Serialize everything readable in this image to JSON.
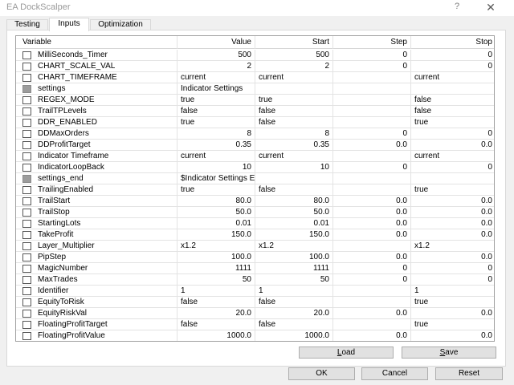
{
  "window": {
    "title": "EA DockScalper",
    "help_glyph": "?",
    "close_glyph": "✕"
  },
  "tabs": [
    "Testing",
    "Inputs",
    "Optimization"
  ],
  "table": {
    "columns": [
      "Variable",
      "Value",
      "Start",
      "Step",
      "Stop"
    ],
    "rows": [
      {
        "var": "MilliSeconds_Timer",
        "checked": false,
        "value": "500",
        "start": "500",
        "step": "0",
        "stop": "0",
        "kind": "num"
      },
      {
        "var": "CHART_SCALE_VAL",
        "checked": false,
        "value": "2",
        "start": "2",
        "step": "0",
        "stop": "0",
        "kind": "num"
      },
      {
        "var": "CHART_TIMEFRAME",
        "checked": false,
        "value": "current",
        "start": "current",
        "step": "",
        "stop": "current",
        "kind": "text"
      },
      {
        "var": "settings",
        "checked": true,
        "value": "Indicator Settings",
        "start": "",
        "step": "",
        "stop": "",
        "kind": "text"
      },
      {
        "var": "REGEX_MODE",
        "checked": false,
        "value": "true",
        "start": "true",
        "step": "",
        "stop": "false",
        "kind": "text"
      },
      {
        "var": "TrailTPLevels",
        "checked": false,
        "value": "false",
        "start": "false",
        "step": "",
        "stop": "false",
        "kind": "text"
      },
      {
        "var": "DDR_ENABLED",
        "checked": false,
        "value": "true",
        "start": "false",
        "step": "",
        "stop": "true",
        "kind": "text"
      },
      {
        "var": "DDMaxOrders",
        "checked": false,
        "value": "8",
        "start": "8",
        "step": "0",
        "stop": "0",
        "kind": "num"
      },
      {
        "var": "DDProfitTarget",
        "checked": false,
        "value": "0.35",
        "start": "0.35",
        "step": "0.0",
        "stop": "0.0",
        "kind": "num"
      },
      {
        "var": "Indicator Timeframe",
        "checked": false,
        "value": "current",
        "start": "current",
        "step": "",
        "stop": "current",
        "kind": "text"
      },
      {
        "var": "IndicatorLoopBack",
        "checked": false,
        "value": "10",
        "start": "10",
        "step": "0",
        "stop": "0",
        "kind": "num"
      },
      {
        "var": "settings_end",
        "checked": true,
        "value": "$Indicator Settings End",
        "start": "",
        "step": "",
        "stop": "",
        "kind": "text"
      },
      {
        "var": "TrailingEnabled",
        "checked": false,
        "value": "true",
        "start": "false",
        "step": "",
        "stop": "true",
        "kind": "text"
      },
      {
        "var": "TrailStart",
        "checked": false,
        "value": "80.0",
        "start": "80.0",
        "step": "0.0",
        "stop": "0.0",
        "kind": "num"
      },
      {
        "var": "TrailStop",
        "checked": false,
        "value": "50.0",
        "start": "50.0",
        "step": "0.0",
        "stop": "0.0",
        "kind": "num"
      },
      {
        "var": "StartingLots",
        "checked": false,
        "value": "0.01",
        "start": "0.01",
        "step": "0.0",
        "stop": "0.0",
        "kind": "num"
      },
      {
        "var": "TakeProfit",
        "checked": false,
        "value": "150.0",
        "start": "150.0",
        "step": "0.0",
        "stop": "0.0",
        "kind": "num"
      },
      {
        "var": "Layer_Multiplier",
        "checked": false,
        "value": "x1.2",
        "start": "x1.2",
        "step": "",
        "stop": "x1.2",
        "kind": "text"
      },
      {
        "var": "PipStep",
        "checked": false,
        "value": "100.0",
        "start": "100.0",
        "step": "0.0",
        "stop": "0.0",
        "kind": "num"
      },
      {
        "var": "MagicNumber",
        "checked": false,
        "value": "1111",
        "start": "1111",
        "step": "0",
        "stop": "0",
        "kind": "num"
      },
      {
        "var": "MaxTrades",
        "checked": false,
        "value": "50",
        "start": "50",
        "step": "0",
        "stop": "0",
        "kind": "num"
      },
      {
        "var": "Identifier",
        "checked": false,
        "value": "1",
        "start": "1",
        "step": "",
        "stop": "1",
        "kind": "text"
      },
      {
        "var": "EquityToRisk",
        "checked": false,
        "value": "false",
        "start": "false",
        "step": "",
        "stop": "true",
        "kind": "text"
      },
      {
        "var": "EquityRiskVal",
        "checked": false,
        "value": "20.0",
        "start": "20.0",
        "step": "0.0",
        "stop": "0.0",
        "kind": "num"
      },
      {
        "var": "FloatingProfitTarget",
        "checked": false,
        "value": "false",
        "start": "false",
        "step": "",
        "stop": "true",
        "kind": "text"
      },
      {
        "var": "FloatingProfitValue",
        "checked": false,
        "value": "1000.0",
        "start": "1000.0",
        "step": "0.0",
        "stop": "0.0",
        "kind": "num"
      }
    ]
  },
  "buttons": {
    "load": "Load",
    "load_access_key": "L",
    "load_rest": "oad",
    "save": "Save",
    "save_access_key": "S",
    "save_rest": "ave",
    "ok": "OK",
    "cancel": "Cancel",
    "reset": "Reset"
  }
}
